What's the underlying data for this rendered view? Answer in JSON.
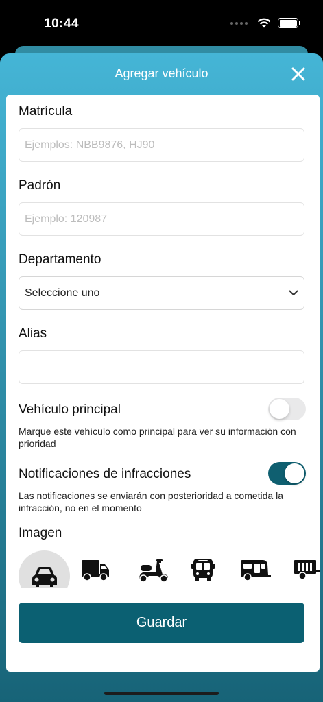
{
  "status": {
    "time": "10:44"
  },
  "sheet": {
    "title": "Agregar vehículo"
  },
  "form": {
    "matricula": {
      "label": "Matrícula",
      "placeholder": "Ejemplos: NBB9876, HJ90",
      "value": ""
    },
    "padron": {
      "label": "Padrón",
      "placeholder": "Ejemplo: 120987",
      "value": ""
    },
    "departamento": {
      "label": "Departamento",
      "selected": "Seleccione uno"
    },
    "alias": {
      "label": "Alias",
      "value": ""
    },
    "principal": {
      "label": "Vehículo principal",
      "enabled": false,
      "help": "Marque este vehículo como principal para ver su información con prioridad"
    },
    "notificaciones": {
      "label": "Notificaciones de infracciones",
      "enabled": true,
      "help": "Las notificaciones se enviarán con posterioridad a cometida la infracción, no en el momento"
    },
    "imagen": {
      "label": "Imagen",
      "options": [
        "car-icon",
        "truck-icon",
        "scooter-icon",
        "bus-icon",
        "camper-icon",
        "trailer-icon"
      ],
      "selected": "car-icon"
    },
    "save_label": "Guardar"
  },
  "colors": {
    "accent": "#0b6072",
    "header": "#45b5d6",
    "toggle_on": "#0f5f70"
  }
}
